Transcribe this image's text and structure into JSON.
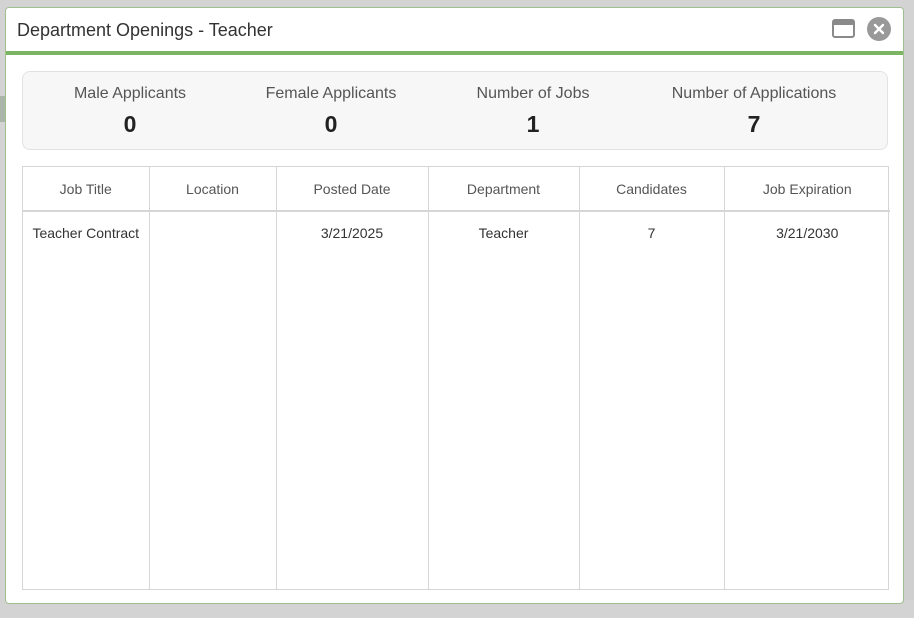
{
  "dialog": {
    "title": "Department Openings - Teacher",
    "controls": {
      "maximize_icon": "window-maximize-icon",
      "close_icon": "close-circle-icon"
    }
  },
  "stats": [
    {
      "label": "Male Applicants",
      "value": "0"
    },
    {
      "label": "Female Applicants",
      "value": "0"
    },
    {
      "label": "Number of Jobs",
      "value": "1"
    },
    {
      "label": "Number of Applications",
      "value": "7"
    }
  ],
  "table": {
    "columns": [
      "Job Title",
      "Location",
      "Posted Date",
      "Department",
      "Candidates",
      "Job Expiration"
    ],
    "rows": [
      [
        "Teacher Contract",
        "",
        "3/21/2025",
        "Teacher",
        "7",
        "3/21/2030"
      ]
    ]
  },
  "colors": {
    "accent": "#7cb561",
    "close_button": "#999999",
    "border": "#d6d6d6"
  }
}
